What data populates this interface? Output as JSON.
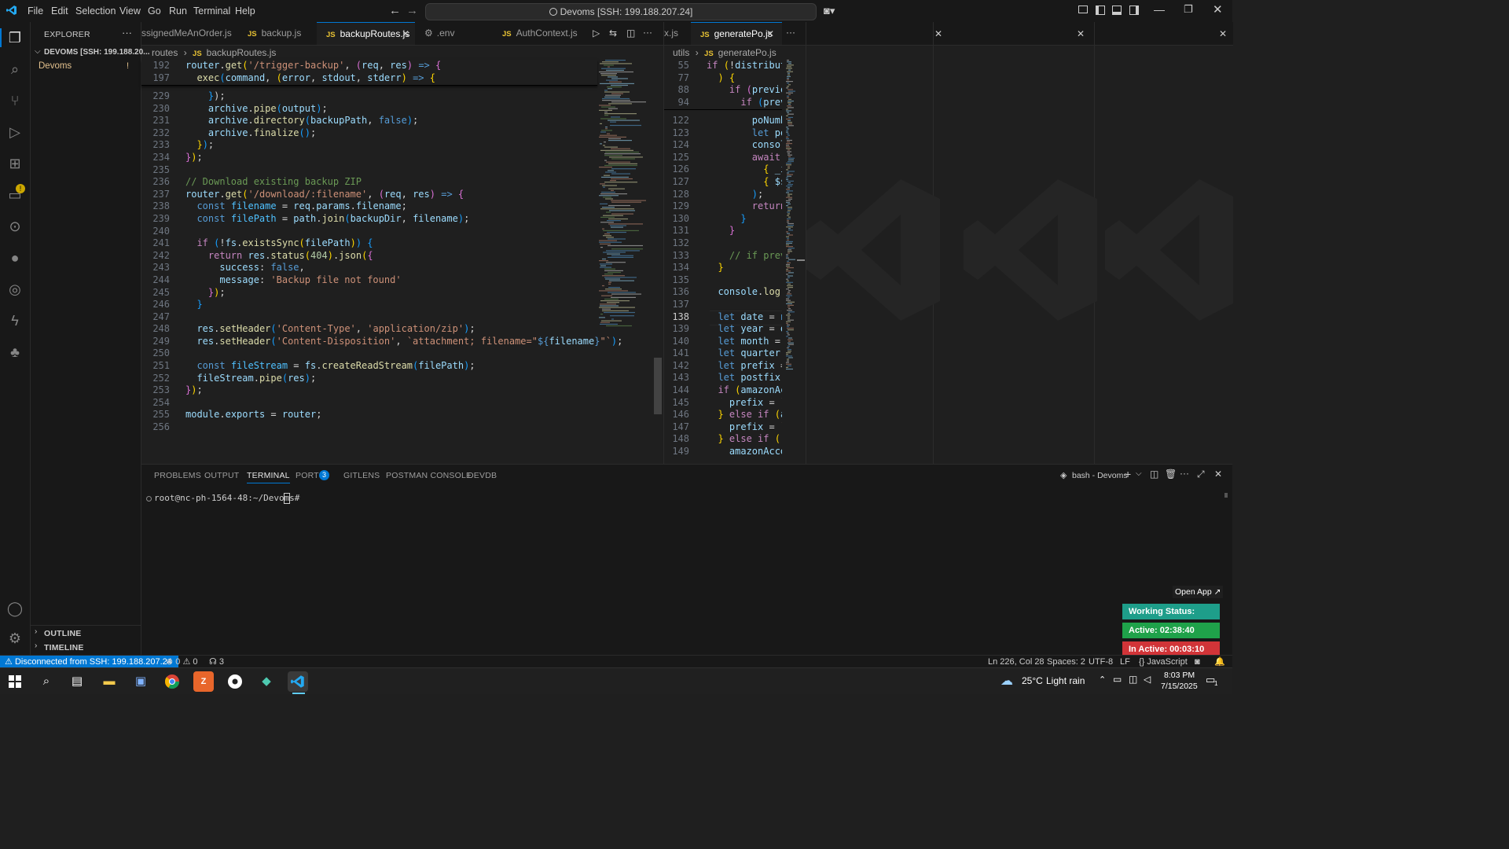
{
  "titlebar": {
    "menus": [
      "File",
      "Edit",
      "Selection",
      "View",
      "Go",
      "Run",
      "Terminal",
      "Help"
    ],
    "command_center": "Devoms [SSH: 199.188.207.24]"
  },
  "sidebar": {
    "title": "EXPLORER",
    "root": "DEVOMS [SSH: 199.188.20...",
    "folder": "Devoms",
    "folder_badge": "!",
    "outline": "OUTLINE",
    "timeline": "TIMELINE"
  },
  "left_tabs": [
    {
      "label": "ssignedMeAnOrder.js",
      "icon": ""
    },
    {
      "label": "backup.js",
      "icon": "JS"
    },
    {
      "label": "backupRoutes.js",
      "icon": "JS",
      "active": true
    },
    {
      "label": ".env",
      "icon": "gear"
    },
    {
      "label": "AuthContext.js",
      "icon": "JS"
    }
  ],
  "left_breadcrumb": {
    "folder": "routes",
    "file": "backupRoutes.js"
  },
  "right_tabs": [
    {
      "label": "x.js"
    },
    {
      "label": "generatePo.js",
      "icon": "JS"
    }
  ],
  "right_breadcrumb": {
    "folder": "utils",
    "file": "generatePo.js"
  },
  "left_code": {
    "sticky_lines": [
      "192",
      "197"
    ],
    "lines": [
      "229",
      "230",
      "231",
      "232",
      "233",
      "234",
      "235",
      "236",
      "237",
      "238",
      "239",
      "240",
      "241",
      "242",
      "243",
      "244",
      "245",
      "246",
      "247",
      "248",
      "249",
      "250",
      "251",
      "252",
      "253",
      "254",
      "255",
      "256"
    ]
  },
  "right_code": {
    "sticky_lines": [
      "55",
      "77",
      "88",
      "94"
    ],
    "lines": [
      "122",
      "123",
      "124",
      "125",
      "126",
      "127",
      "128",
      "129",
      "130",
      "131",
      "132",
      "133",
      "134",
      "135",
      "136",
      "137",
      "138",
      "139",
      "140",
      "141",
      "142",
      "143",
      "144",
      "145",
      "146",
      "147",
      "148",
      "149"
    ],
    "current_line": "138"
  },
  "panel": {
    "tabs": [
      "PROBLEMS",
      "OUTPUT",
      "TERMINAL",
      "PORTS",
      "GITLENS",
      "POSTMAN CONSOLE",
      "DEVDB"
    ],
    "ports_badge": "3",
    "terminal_name": "bash - Devoms",
    "prompt": "root@nc-ph-1564-48:~/Devoms#"
  },
  "widget": {
    "open_app": "Open App ↗",
    "working_status": "Working Status: Active",
    "active": "Active: 02:38:40",
    "inactive": "In Active: 00:03:10",
    "colors": {
      "working": "#1e9e8a",
      "active": "#1fa24a",
      "inactive": "#d13438"
    }
  },
  "statusbar": {
    "remote": "Disconnected from SSH: 199.188.207.24",
    "errors": "0",
    "warnings": "0",
    "ports": "3",
    "position": "Ln 226, Col 28",
    "spaces": "Spaces: 2",
    "encoding": "UTF-8",
    "eol": "LF",
    "language": "JavaScript"
  },
  "taskbar": {
    "weather": "25°C",
    "weather_desc": "Light rain",
    "time": "8:03 PM",
    "date": "7/15/2025",
    "notif": "1"
  }
}
